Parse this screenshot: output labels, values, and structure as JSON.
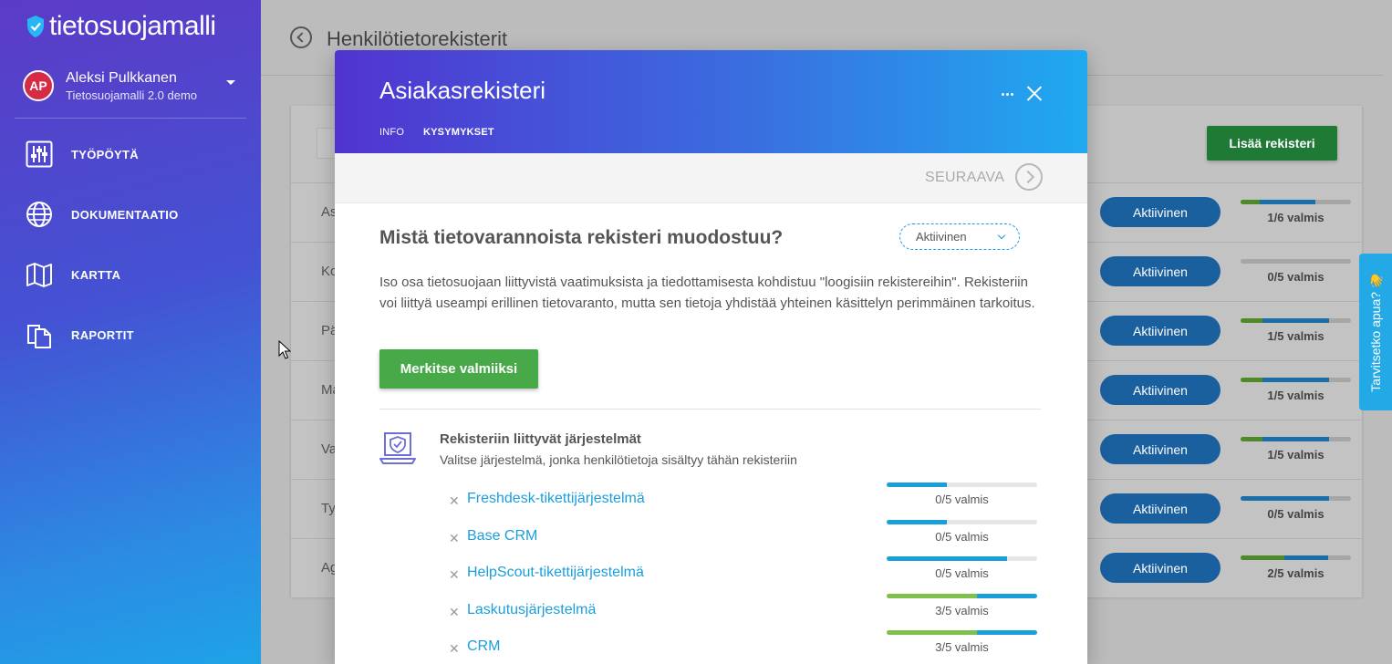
{
  "sidebar": {
    "logo_text": "tietosuojamalli",
    "user": {
      "initials": "AP",
      "name": "Aleksi Pulkkanen",
      "org": "Tietosuojamalli 2.0 demo"
    },
    "nav": [
      {
        "label": "TYÖPÖYTÄ",
        "icon": "sliders-icon"
      },
      {
        "label": "DOKUMENTAATIO",
        "icon": "globe-icon"
      },
      {
        "label": "KARTTA",
        "icon": "map-icon"
      },
      {
        "label": "RAPORTIT",
        "icon": "documents-icon"
      }
    ]
  },
  "main": {
    "title": "Henkilötietorekisterit",
    "add_button": "Lisää rekisteri",
    "rows": [
      {
        "name": "As",
        "status": "Aktiivinen",
        "progress_label": "1/6 valmis",
        "done_fraction": 0.17,
        "total_fraction": 0.67
      },
      {
        "name": "Ko",
        "status": "Aktiivinen",
        "progress_label": "0/5 valmis",
        "done_fraction": 0,
        "total_fraction": 0
      },
      {
        "name": "Pä",
        "status": "Aktiivinen",
        "progress_label": "1/5 valmis",
        "done_fraction": 0.2,
        "total_fraction": 0.8
      },
      {
        "name": "Ma",
        "status": "Aktiivinen",
        "progress_label": "1/5 valmis",
        "done_fraction": 0.2,
        "total_fraction": 0.8
      },
      {
        "name": "Va",
        "status": "Aktiivinen",
        "progress_label": "1/5 valmis",
        "done_fraction": 0.2,
        "total_fraction": 0.8
      },
      {
        "name": "Ty",
        "status": "Aktiivinen",
        "progress_label": "0/5 valmis",
        "done_fraction": 0,
        "total_fraction": 0.8
      },
      {
        "name": "Ag",
        "status": "Aktiivinen",
        "progress_label": "2/5 valmis",
        "done_fraction": 0.4,
        "total_fraction": 0.8
      }
    ]
  },
  "help_tab": {
    "label": "Tarvitsetko apua? 👋"
  },
  "modal": {
    "title": "Asiakasrekisteri",
    "tabs": {
      "info": "INFO",
      "questions": "KYSYMYKSET"
    },
    "next_label": "SEURAAVA",
    "question_title": "Mistä tietovarannoista rekisteri muodostuu?",
    "status_value": "Aktiivinen",
    "description": "Iso osa tietosuojaan liittyvistä vaatimuksista ja tiedottamisesta kohdistuu \"loogisiin rekistereihin\". Rekisteriin voi liittyä useampi erillinen tietovaranto, mutta sen tietoja yhdistää yhteinen käsittelyn perimmäinen tarkoitus.",
    "mark_done_button": "Merkitse valmiiksi",
    "systems_title": "Rekisteriin liittyvät järjestelmät",
    "systems_subtitle": "Valitse järjestelmä, jonka henkilötietoja sisältyy tähän rekisteriin",
    "systems": [
      {
        "name": "Freshdesk-tikettijärjestelmä",
        "progress_label": "0/5 valmis",
        "done_fraction": 0,
        "total_fraction": 0.4
      },
      {
        "name": "Base CRM",
        "progress_label": "0/5 valmis",
        "done_fraction": 0,
        "total_fraction": 0.4
      },
      {
        "name": "HelpScout-tikettijärjestelmä",
        "progress_label": "0/5 valmis",
        "done_fraction": 0,
        "total_fraction": 0.8
      },
      {
        "name": "Laskutusjärjestelmä",
        "progress_label": "3/5 valmis",
        "done_fraction": 0.6,
        "total_fraction": 1.0
      },
      {
        "name": "CRM",
        "progress_label": "3/5 valmis",
        "done_fraction": 0.6,
        "total_fraction": 1.0
      }
    ]
  },
  "colors": {
    "accent_blue": "#1a9fdc",
    "done_green": "#7ec04b",
    "button_green": "#47a948",
    "avatar_red": "#d52b46"
  }
}
